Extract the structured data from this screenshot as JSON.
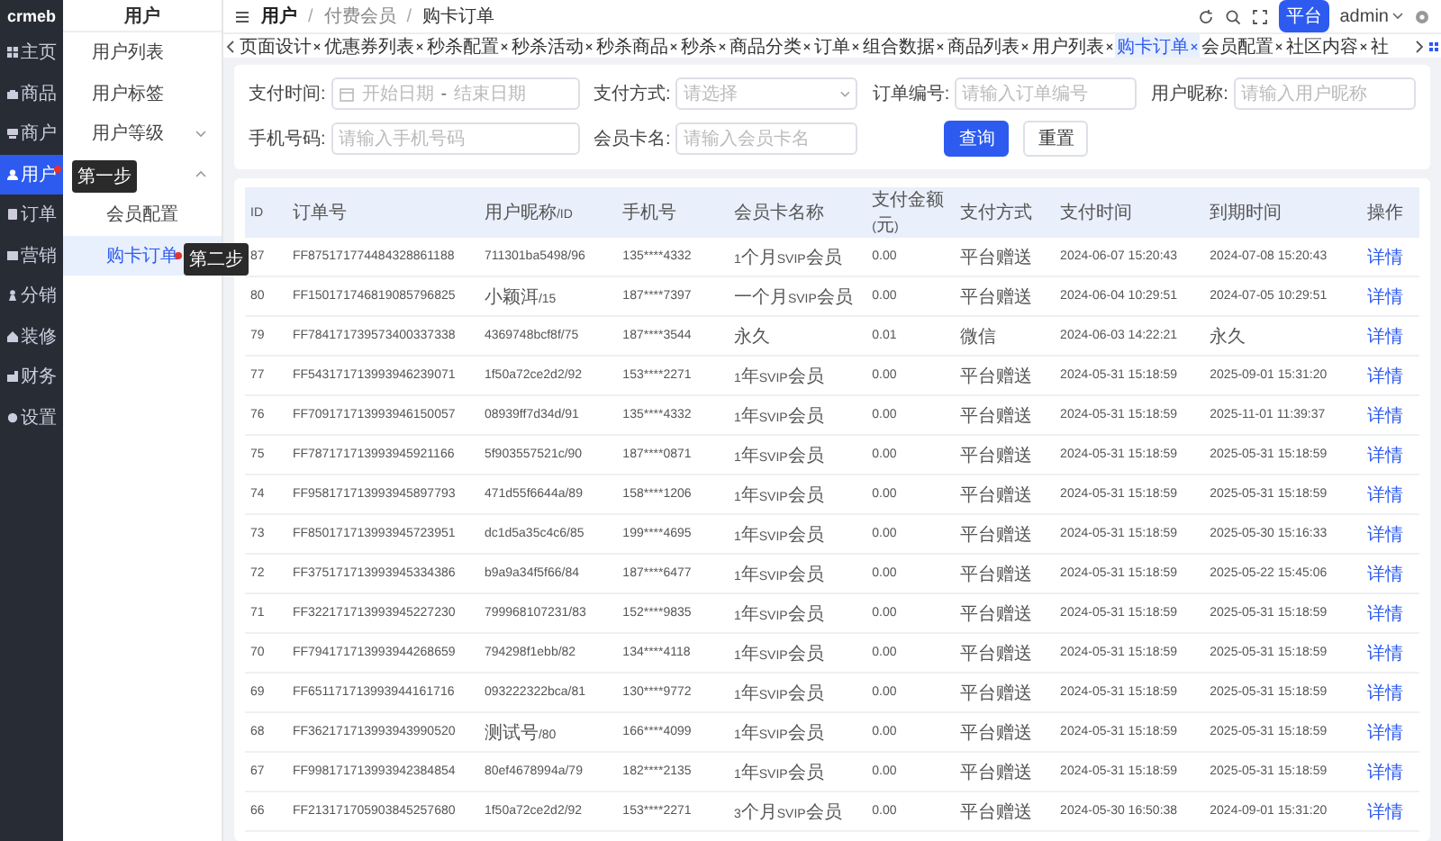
{
  "sidebar": {
    "logo": "crmeb",
    "items": [
      {
        "label": "主页",
        "selected": false
      },
      {
        "label": "商品",
        "selected": false
      },
      {
        "label": "商户",
        "selected": false
      },
      {
        "label": "用户",
        "selected": true,
        "marker": "第一步"
      },
      {
        "label": "订单",
        "selected": false
      },
      {
        "label": "营销",
        "selected": false
      },
      {
        "label": "分销",
        "selected": false
      },
      {
        "label": "装修",
        "selected": false
      },
      {
        "label": "财务",
        "selected": false
      },
      {
        "label": "设置",
        "selected": false
      }
    ]
  },
  "submenu": {
    "title": "用户",
    "items": [
      {
        "label": "用户列表",
        "selected": false
      },
      {
        "label": "用户标签",
        "selected": false
      },
      {
        "label": "用户等级",
        "selected": false,
        "expanded": false
      },
      {
        "expanded": true,
        "children": [
          {
            "label": "会员配置",
            "selected": false
          },
          {
            "label": "购卡订单",
            "selected": true,
            "marker": "第二步"
          }
        ]
      }
    ]
  },
  "breadcrumb": {
    "separator": "/",
    "items": [
      "用户",
      "付费会员",
      "购卡订单"
    ]
  },
  "header": {
    "platform_button": "平台",
    "user": "admin"
  },
  "tabs": [
    {
      "label": "页面设计",
      "selected": false,
      "closable": true
    },
    {
      "label": "优惠券列表",
      "selected": false,
      "closable": true
    },
    {
      "label": "秒杀配置",
      "selected": false,
      "closable": true
    },
    {
      "label": "秒杀活动",
      "selected": false,
      "closable": true
    },
    {
      "label": "秒杀商品",
      "selected": false,
      "closable": true
    },
    {
      "label": "秒杀",
      "selected": false,
      "closable": true
    },
    {
      "label": "商品分类",
      "selected": false,
      "closable": true
    },
    {
      "label": "订单",
      "selected": false,
      "closable": true
    },
    {
      "label": "组合数据",
      "selected": false,
      "closable": true
    },
    {
      "label": "商品列表",
      "selected": false,
      "closable": true
    },
    {
      "label": "用户列表",
      "selected": false,
      "closable": true
    },
    {
      "label": "购卡订单",
      "selected": true,
      "closable": true
    },
    {
      "label": "会员配置",
      "selected": false,
      "closable": true
    },
    {
      "label": "社区内容",
      "selected": false,
      "closable": true
    },
    {
      "label": "社",
      "selected": false,
      "closable": false
    }
  ],
  "filters": [
    {
      "label": "支付时间:",
      "kind": "daterange",
      "start_placeholder": "开始日期",
      "range_separator": "-",
      "end_placeholder": "结束日期"
    },
    {
      "label": "支付方式:",
      "kind": "select",
      "placeholder": "请选择"
    },
    {
      "label": "订单编号:",
      "kind": "text",
      "placeholder": "请输入订单编号"
    },
    {
      "label": "用户昵称:",
      "kind": "text",
      "placeholder": "请输入用户昵称"
    },
    {
      "label": "手机号码:",
      "kind": "text",
      "placeholder": "请输入手机号码"
    },
    {
      "label": "会员卡名:",
      "kind": "text",
      "placeholder": "请输入会员卡名"
    }
  ],
  "actions": [
    {
      "label": "查询",
      "kind": "primary"
    },
    {
      "label": "重置",
      "kind": "default"
    }
  ],
  "table": {
    "columns": [
      {
        "label": "ID",
        "kind": "text"
      },
      {
        "label": "订单号",
        "kind": "text"
      },
      {
        "label": "用户昵称/ID",
        "kind": "text"
      },
      {
        "label": "手机号",
        "kind": "text"
      },
      {
        "label": "会员卡名称",
        "kind": "text"
      },
      {
        "label": "支付金额(元)",
        "kind": "text"
      },
      {
        "label": "支付方式",
        "kind": "text"
      },
      {
        "label": "支付时间",
        "kind": "text"
      },
      {
        "label": "到期时间",
        "kind": "text"
      },
      {
        "label": "操作",
        "kind": "link"
      }
    ],
    "rows": [
      [
        "87",
        "FF875171774484328861188",
        "711301ba5498/96",
        "135****4332",
        "1个月SVIP会员",
        "0.00",
        "平台赠送",
        "2024-06-07 15:20:43",
        "2024-07-08 15:20:43",
        "详情"
      ],
      [
        "80",
        "FF150171746819085796825",
        "小颖洱/15",
        "187****7397",
        "一个月SVIP会员",
        "0.00",
        "平台赠送",
        "2024-06-04 10:29:51",
        "2024-07-05 10:29:51",
        "详情"
      ],
      [
        "79",
        "FF784171739573400337338",
        "4369748bcf8f/75",
        "187****3544",
        "永久",
        "0.01",
        "微信",
        "2024-06-03 14:22:21",
        "永久",
        "详情"
      ],
      [
        "77",
        "FF543171713993946239071",
        "1f50a72ce2d2/92",
        "153****2271",
        "1年SVIP会员",
        "0.00",
        "平台赠送",
        "2024-05-31 15:18:59",
        "2025-09-01 15:31:20",
        "详情"
      ],
      [
        "76",
        "FF709171713993946150057",
        "08939ff7d34d/91",
        "135****4332",
        "1年SVIP会员",
        "0.00",
        "平台赠送",
        "2024-05-31 15:18:59",
        "2025-11-01 11:39:37",
        "详情"
      ],
      [
        "75",
        "FF787171713993945921166",
        "5f903557521c/90",
        "187****0871",
        "1年SVIP会员",
        "0.00",
        "平台赠送",
        "2024-05-31 15:18:59",
        "2025-05-31 15:18:59",
        "详情"
      ],
      [
        "74",
        "FF958171713993945897793",
        "471d55f6644a/89",
        "158****1206",
        "1年SVIP会员",
        "0.00",
        "平台赠送",
        "2024-05-31 15:18:59",
        "2025-05-31 15:18:59",
        "详情"
      ],
      [
        "73",
        "FF850171713993945723951",
        "dc1d5a35c4c6/85",
        "199****4695",
        "1年SVIP会员",
        "0.00",
        "平台赠送",
        "2024-05-31 15:18:59",
        "2025-05-30 15:16:33",
        "详情"
      ],
      [
        "72",
        "FF375171713993945334386",
        "b9a9a34f5f66/84",
        "187****6477",
        "1年SVIP会员",
        "0.00",
        "平台赠送",
        "2024-05-31 15:18:59",
        "2025-05-22 15:45:06",
        "详情"
      ],
      [
        "71",
        "FF322171713993945227230",
        "799968107231/83",
        "152****9835",
        "1年SVIP会员",
        "0.00",
        "平台赠送",
        "2024-05-31 15:18:59",
        "2025-05-31 15:18:59",
        "详情"
      ],
      [
        "70",
        "FF794171713993944268659",
        "794298f1ebb/82",
        "134****4118",
        "1年SVIP会员",
        "0.00",
        "平台赠送",
        "2024-05-31 15:18:59",
        "2025-05-31 15:18:59",
        "详情"
      ],
      [
        "69",
        "FF651171713993944161716",
        "093222322bca/81",
        "130****9772",
        "1年SVIP会员",
        "0.00",
        "平台赠送",
        "2024-05-31 15:18:59",
        "2025-05-31 15:18:59",
        "详情"
      ],
      [
        "68",
        "FF362171713993943990520",
        "测试号/80",
        "166****4099",
        "1年SVIP会员",
        "0.00",
        "平台赠送",
        "2024-05-31 15:18:59",
        "2025-05-31 15:18:59",
        "详情"
      ],
      [
        "67",
        "FF998171713993942384854",
        "80ef4678994a/79",
        "182****2135",
        "1年SVIP会员",
        "0.00",
        "平台赠送",
        "2024-05-31 15:18:59",
        "2025-05-31 15:18:59",
        "详情"
      ],
      [
        "66",
        "FF213171705903845257680",
        "1f50a72ce2d2/92",
        "153****2271",
        "3个月SVIP会员",
        "0.00",
        "平台赠送",
        "2024-05-30 16:50:38",
        "2024-09-01 15:31:20",
        "详情"
      ]
    ]
  }
}
